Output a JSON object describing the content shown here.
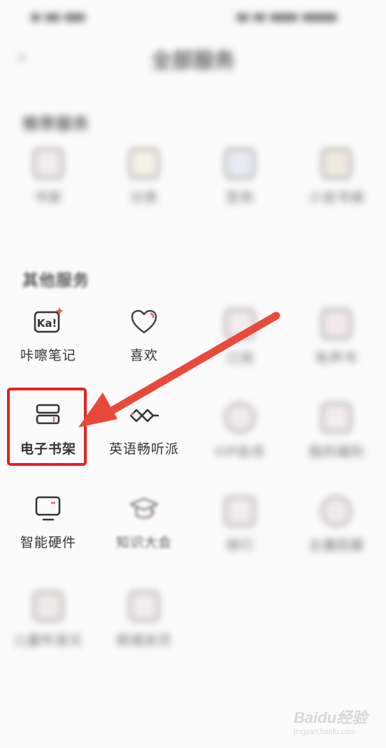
{
  "page": {
    "title": "全部服务"
  },
  "sections": {
    "recommend": {
      "title": "推荐服务",
      "items": [
        {
          "label": "书架",
          "icon": "blurred-service-icon"
        },
        {
          "label": "分类",
          "icon": "blurred-service-icon"
        },
        {
          "label": "签到",
          "icon": "blurred-service-icon"
        },
        {
          "label": "小说书城",
          "icon": "blurred-service-icon"
        }
      ]
    },
    "other": {
      "title": "其他服务",
      "items": [
        {
          "label": "咔嚓笔记",
          "icon": "ka-note-icon"
        },
        {
          "label": "喜欢",
          "icon": "heart-icon"
        },
        {
          "label": "订阅",
          "icon": "blurred-service-icon"
        },
        {
          "label": "有声书",
          "icon": "blurred-service-icon"
        },
        {
          "label": "电子书架",
          "icon": "bookshelf-icon"
        },
        {
          "label": "英语畅听派",
          "icon": "infinity-icon"
        },
        {
          "label": "VIP会员",
          "icon": "blurred-service-icon"
        },
        {
          "label": "我的福利",
          "icon": "blurred-service-icon"
        },
        {
          "label": "智能硬件",
          "icon": "monitor-icon"
        },
        {
          "label": "知识大会",
          "icon": "graduation-cap-icon"
        },
        {
          "label": "排行",
          "icon": "blurred-service-icon"
        },
        {
          "label": "主播招募",
          "icon": "blurred-service-icon"
        },
        {
          "label": "儿童听音乐",
          "icon": "blurred-service-icon"
        },
        {
          "label": "商城会员",
          "icon": "blurred-service-icon"
        }
      ]
    }
  },
  "annotation": {
    "highlight_color": "#e82020",
    "arrow_color": "#e84a3a"
  },
  "watermark": {
    "brand": "Baidu",
    "brand_cn": "经验",
    "url": "jingyan.baidu.com"
  }
}
